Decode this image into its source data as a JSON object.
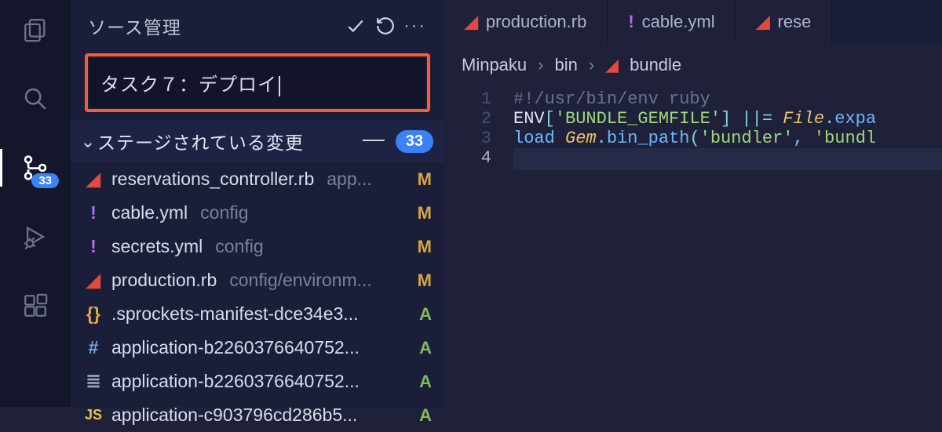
{
  "activityBar": {
    "scmBadge": "33"
  },
  "scm": {
    "title": "ソース管理",
    "commitMessage": "タスク７：デプロイ",
    "stagedSection": {
      "label": "ステージされている変更",
      "count": "33"
    },
    "files": [
      {
        "iconClass": "ic-ruby",
        "iconGlyph": "◢",
        "name": "reservations_controller.rb",
        "path": "app...",
        "status": "M"
      },
      {
        "iconClass": "ic-yml",
        "iconGlyph": "!",
        "name": "cable.yml",
        "path": "config",
        "status": "M"
      },
      {
        "iconClass": "ic-yml",
        "iconGlyph": "!",
        "name": "secrets.yml",
        "path": "config",
        "status": "M"
      },
      {
        "iconClass": "ic-ruby",
        "iconGlyph": "◢",
        "name": "production.rb",
        "path": "config/environm...",
        "status": "M"
      },
      {
        "iconClass": "ic-brace",
        "iconGlyph": "{}",
        "name": ".sprockets-manifest-dce34e3...",
        "path": "",
        "status": "A"
      },
      {
        "iconClass": "ic-hash",
        "iconGlyph": "#",
        "name": "application-b2260376640752...",
        "path": "",
        "status": "A"
      },
      {
        "iconClass": "ic-lines",
        "iconGlyph": "≣",
        "name": "application-b2260376640752...",
        "path": "",
        "status": "A"
      },
      {
        "iconClass": "ic-js",
        "iconGlyph": "JS",
        "name": "application-c903796cd286b5...",
        "path": "",
        "status": "A"
      }
    ]
  },
  "tabs": [
    {
      "iconClass": "ic-ruby",
      "iconGlyph": "◢",
      "label": "production.rb"
    },
    {
      "iconClass": "ic-yml",
      "iconGlyph": "!",
      "label": "cable.yml"
    },
    {
      "iconClass": "ic-ruby",
      "iconGlyph": "◢",
      "label": "rese"
    }
  ],
  "breadcrumb": {
    "p0": "Minpaku",
    "p1": "bin",
    "p2": "bundle"
  },
  "code": {
    "l1_text": "#!/usr/bin/env ruby",
    "l2_a": "ENV",
    "l2_b": "[",
    "l2_c": "'BUNDLE_GEMFILE'",
    "l2_d": "]",
    "l2_e": " ||= ",
    "l2_f": "File",
    "l2_g": ".",
    "l2_h": "expa",
    "l3_a": "load",
    "l3_b": " ",
    "l3_c": "Gem",
    "l3_d": ".",
    "l3_e": "bin_path",
    "l3_f": "(",
    "l3_g": "'bundler'",
    "l3_h": ", ",
    "l3_i": "'bundl",
    "n1": "1",
    "n2": "2",
    "n3": "3",
    "n4": "4"
  }
}
